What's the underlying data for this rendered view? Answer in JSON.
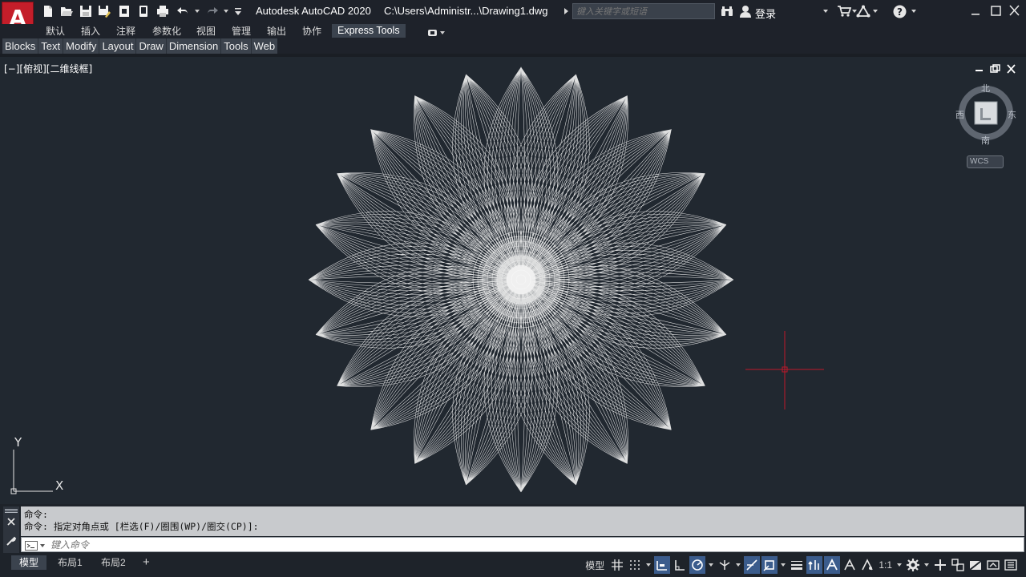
{
  "app": {
    "logo_letter": "A",
    "title": "Autodesk AutoCAD 2020",
    "file_path": "C:\\Users\\Administr...\\Drawing1.dwg"
  },
  "search": {
    "placeholder": "键入关键字或短语"
  },
  "user": {
    "login_label": "登录"
  },
  "ribbon": {
    "tabs": [
      "默认",
      "插入",
      "注释",
      "参数化",
      "视图",
      "管理",
      "输出",
      "协作",
      "Express Tools"
    ],
    "active_tab": "Express Tools"
  },
  "menu": {
    "items": [
      "Blocks",
      "Text",
      "Modify",
      "Layout",
      "Draw",
      "Dimension",
      "Tools",
      "Web"
    ]
  },
  "viewport": {
    "label": "[−][俯视][二维线框]",
    "compass": {
      "north": "北",
      "south": "南",
      "east": "东",
      "west": "西"
    },
    "wcs_label": "WCS",
    "ucs": {
      "x_label": "X",
      "y_label": "Y"
    },
    "drawing": {
      "type": "parametric-flower",
      "petal_count": 24,
      "line_color": "#ffffff"
    },
    "crosshair_color": "#c0182a"
  },
  "command": {
    "history": [
      "命令:",
      "命令: 指定对角点或 [栏选(F)/圈围(WP)/圈交(CP)]:"
    ],
    "placeholder": "键入命令"
  },
  "layout_tabs": {
    "tabs": [
      "模型",
      "布局1",
      "布局2"
    ],
    "active": "模型",
    "add_symbol": "+"
  },
  "status": {
    "model_label": "模型",
    "scale_label": "1:1"
  },
  "colors": {
    "background": "#212830",
    "titlebar": "#1e222a",
    "accent_red": "#c41e2a",
    "active_toggle": "#3b5c8c"
  }
}
